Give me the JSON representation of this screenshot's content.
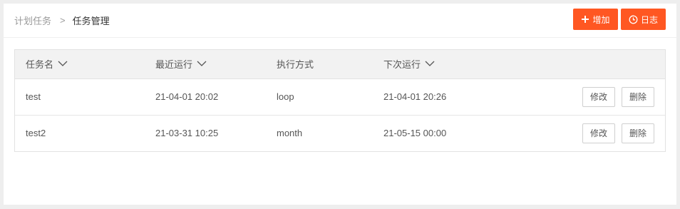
{
  "breadcrumb": {
    "parent": "计划任务",
    "separator": ">",
    "current": "任务管理"
  },
  "toolbar": {
    "add_label": "增加",
    "log_label": "日志",
    "accent_color": "#ff5722"
  },
  "table": {
    "columns": [
      {
        "label": "任务名",
        "sortable": true
      },
      {
        "label": "最近运行",
        "sortable": true
      },
      {
        "label": "执行方式",
        "sortable": false
      },
      {
        "label": "下次运行",
        "sortable": true
      },
      {
        "label": "",
        "sortable": false
      }
    ],
    "rows": [
      {
        "name": "test",
        "last_run": "21-04-01 20:02",
        "mode": "loop",
        "next_run": "21-04-01 20:26",
        "edit_label": "修改",
        "delete_label": "删除"
      },
      {
        "name": "test2",
        "last_run": "21-03-31 10:25",
        "mode": "month",
        "next_run": "21-05-15 00:00",
        "edit_label": "修改",
        "delete_label": "删除"
      }
    ]
  }
}
